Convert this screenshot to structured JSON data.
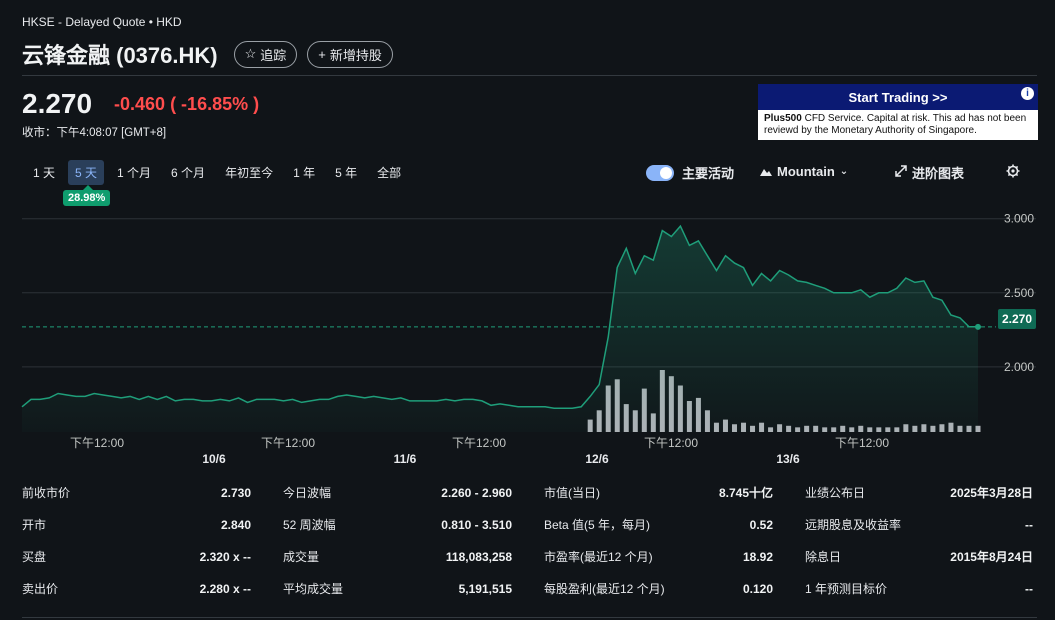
{
  "header": {
    "exchange": "HKSE - Delayed Quote • HKD",
    "title": "云锋金融 (0376.HK)",
    "follow_label": "追踪",
    "add_holding_label": "新增持股"
  },
  "quote": {
    "price": "2.270",
    "change": "-0.460",
    "change_pct": "( -16.85% )",
    "close_time": "收市：下午4:08:07 [GMT+8]"
  },
  "ad": {
    "headline": "Start Trading >>",
    "info_icon": "i",
    "brand": "Plus500",
    "body": " CFD Service. Capital at risk. This ad has not been reviewd by the Monetary Authority of Singapore."
  },
  "ranges": {
    "items": [
      "1 天",
      "5 天",
      "1 个月",
      "6 个月",
      "年初至今",
      "1 年",
      "5 年",
      "全部"
    ],
    "active_index": 1,
    "active_change": "28.98%"
  },
  "controls": {
    "main_activity_label": "主要活动",
    "chart_type_label": "Mountain",
    "advanced_chart_label": "进阶图表",
    "settings_icon": "gear-icon"
  },
  "chart_data": {
    "type": "area",
    "price_tag": "2.270",
    "y_ticks": [
      "3.000",
      "2.500",
      "2.000"
    ],
    "y_tick_values": [
      3.0,
      2.5,
      2.0
    ],
    "ylim": [
      1.56,
      3.16
    ],
    "previous_close": 2.27,
    "x_time_labels": [
      "下午12:00",
      "下午12:00",
      "下午12:00",
      "下午12:00",
      "下午12:00"
    ],
    "x_date_labels": [
      "10/6",
      "11/6",
      "12/6",
      "13/6"
    ],
    "line_color": "#1f9e7a",
    "series": [
      {
        "values": [
          1.73,
          1.78,
          1.78,
          1.79,
          1.82,
          1.81,
          1.8,
          1.8,
          1.82,
          1.81,
          1.8,
          1.79,
          1.8,
          1.78,
          1.8,
          1.78,
          1.8,
          1.77,
          1.78,
          1.78,
          1.77,
          1.77,
          1.78,
          1.77,
          1.79,
          1.76,
          1.78,
          1.78,
          1.78,
          1.77,
          1.78,
          1.76,
          1.77,
          1.78,
          1.78,
          1.8,
          1.81,
          1.8,
          1.79,
          1.8,
          1.79,
          1.78,
          1.79,
          1.77,
          1.77,
          1.77,
          1.77,
          1.78,
          1.77,
          1.78,
          1.78,
          1.77,
          1.74,
          1.75,
          1.74,
          1.73,
          1.73,
          1.73,
          1.73,
          1.72,
          1.72,
          1.72,
          1.73,
          1.8,
          1.88,
          2.2,
          2.67,
          2.8,
          2.63,
          2.75,
          2.72,
          2.92,
          2.88,
          2.95,
          2.82,
          2.85,
          2.75,
          2.65,
          2.75,
          2.7,
          2.67,
          2.55,
          2.63,
          2.58,
          2.65,
          2.62,
          2.58,
          2.57,
          2.55,
          2.53,
          2.5,
          2.5,
          2.5,
          2.52,
          2.47,
          2.5,
          2.5,
          2.53,
          2.6,
          2.57,
          2.58,
          2.47,
          2.45,
          2.35,
          2.33,
          2.27,
          2.27
        ]
      }
    ],
    "volume": [
      0,
      0,
      0,
      0,
      0,
      0,
      0,
      0,
      0,
      0,
      0,
      0,
      0,
      0,
      0,
      0,
      0,
      0,
      0,
      0,
      0,
      0,
      0,
      0,
      0,
      0,
      0,
      0,
      0,
      0,
      0,
      0,
      0,
      0,
      0,
      0,
      0,
      0,
      0,
      0,
      0,
      0,
      0,
      0,
      0,
      0,
      0,
      0,
      0,
      0,
      0,
      0,
      0,
      0,
      0,
      0,
      0,
      0,
      0,
      0,
      0,
      0,
      0,
      8,
      14,
      30,
      34,
      18,
      14,
      28,
      12,
      40,
      36,
      30,
      20,
      22,
      14,
      6,
      8,
      5,
      6,
      4,
      6,
      3,
      5,
      4,
      3,
      4,
      4,
      3,
      3,
      4,
      3,
      4,
      3,
      3,
      3,
      3,
      5,
      4,
      5,
      4,
      5,
      6,
      4,
      4,
      4
    ]
  },
  "stats": [
    [
      {
        "label": "前收市价",
        "value": "2.730"
      },
      {
        "label": "开市",
        "value": "2.840"
      },
      {
        "label": "买盘",
        "value": "2.320 x --"
      },
      {
        "label": "卖出价",
        "value": "2.280 x --"
      }
    ],
    [
      {
        "label": "今日波幅",
        "value": "2.260 - 2.960"
      },
      {
        "label": "52 周波幅",
        "value": "0.810 - 3.510"
      },
      {
        "label": "成交量",
        "value": "118,083,258"
      },
      {
        "label": "平均成交量",
        "value": "5,191,515"
      }
    ],
    [
      {
        "label": "市值(当日)",
        "value": "8.745十亿"
      },
      {
        "label": "Beta 值(5 年，每月)",
        "value": "0.52"
      },
      {
        "label": "市盈率(最近12 个月)",
        "value": "18.92"
      },
      {
        "label": "每股盈利(最近12 个月)",
        "value": "0.120"
      }
    ],
    [
      {
        "label": "业绩公布日",
        "value": "2025年3月28日"
      },
      {
        "label": "远期股息及收益率",
        "value": "--"
      },
      {
        "label": "除息日",
        "value": "2015年8月24日"
      },
      {
        "label": "1 年预测目标价",
        "value": "--"
      }
    ]
  ]
}
